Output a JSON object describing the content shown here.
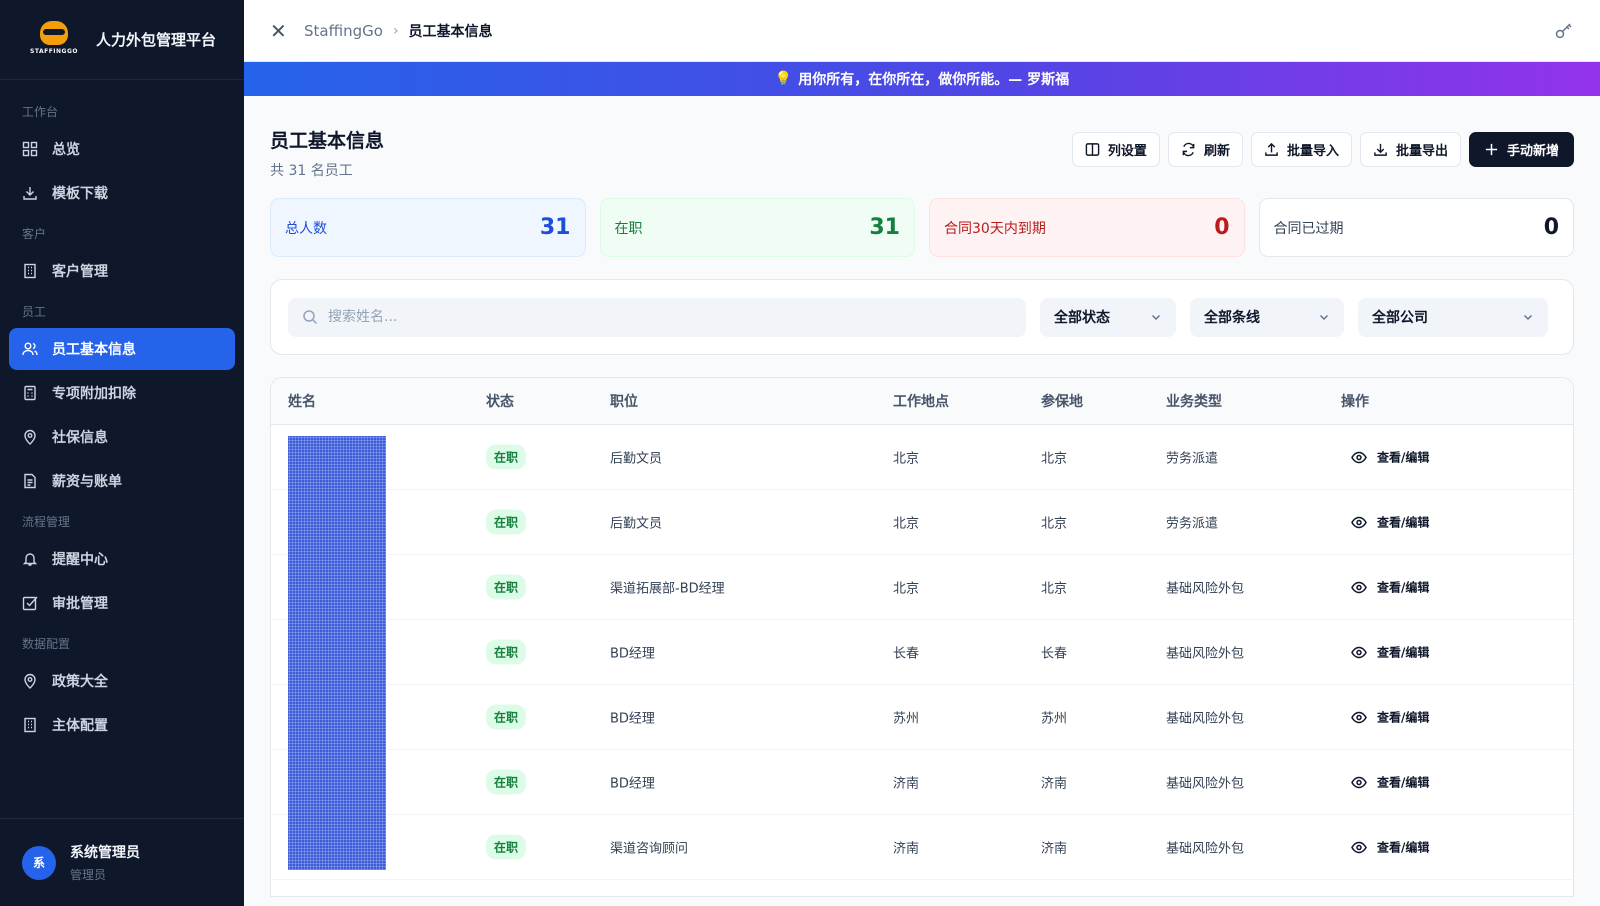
{
  "app": {
    "brand_title": "人力外包管理平台",
    "logo_text": "STAFFINGGO"
  },
  "sidebar": {
    "groups": [
      {
        "label": "工作台",
        "items": [
          {
            "label": "总览",
            "icon": "grid-icon"
          },
          {
            "label": "模板下载",
            "icon": "download-icon"
          }
        ]
      },
      {
        "label": "客户",
        "items": [
          {
            "label": "客户管理",
            "icon": "building-icon"
          }
        ]
      },
      {
        "label": "员工",
        "items": [
          {
            "label": "员工基本信息",
            "icon": "users-icon",
            "active": true
          },
          {
            "label": "专项附加扣除",
            "icon": "calculator-icon"
          },
          {
            "label": "社保信息",
            "icon": "map-pin-icon"
          },
          {
            "label": "薪资与账单",
            "icon": "file-text-icon"
          }
        ]
      },
      {
        "label": "流程管理",
        "items": [
          {
            "label": "提醒中心",
            "icon": "bell-icon"
          },
          {
            "label": "审批管理",
            "icon": "check-square-icon"
          }
        ]
      },
      {
        "label": "数据配置",
        "items": [
          {
            "label": "政策大全",
            "icon": "map-pin-icon"
          },
          {
            "label": "主体配置",
            "icon": "building-icon"
          }
        ]
      }
    ],
    "user": {
      "avatar": "系",
      "name": "系统管理员",
      "role": "管理员"
    }
  },
  "topbar": {
    "breadcrumb_root": "StaffingGo",
    "breadcrumb_sep": "›",
    "breadcrumb_current": "员工基本信息"
  },
  "banner": {
    "text": "用你所有，在你所在，做你所能。— 罗斯福"
  },
  "page": {
    "title": "员工基本信息",
    "subtitle": "共 31 名员工"
  },
  "actions": {
    "columns": "列设置",
    "refresh": "刷新",
    "import": "批量导入",
    "export": "批量导出",
    "add": "手动新增"
  },
  "stats": [
    {
      "label": "总人数",
      "value": "31"
    },
    {
      "label": "在职",
      "value": "31"
    },
    {
      "label": "合同30天内到期",
      "value": "0"
    },
    {
      "label": "合同已过期",
      "value": "0"
    }
  ],
  "filters": {
    "search_placeholder": "搜索姓名...",
    "status": "全部状态",
    "line": "全部条线",
    "company": "全部公司"
  },
  "table": {
    "headers": [
      "姓名",
      "状态",
      "职位",
      "工作地点",
      "参保地",
      "业务类型",
      "操作"
    ],
    "rows": [
      {
        "status": "在职",
        "position": "后勤文员",
        "workplace": "北京",
        "insured": "北京",
        "biz": "劳务派遣",
        "op": "查看/编辑"
      },
      {
        "status": "在职",
        "position": "后勤文员",
        "workplace": "北京",
        "insured": "北京",
        "biz": "劳务派遣",
        "op": "查看/编辑"
      },
      {
        "status": "在职",
        "position": "渠道拓展部-BD经理",
        "workplace": "北京",
        "insured": "北京",
        "biz": "基础风险外包",
        "op": "查看/编辑"
      },
      {
        "status": "在职",
        "position": "BD经理",
        "workplace": "长春",
        "insured": "长春",
        "biz": "基础风险外包",
        "op": "查看/编辑"
      },
      {
        "status": "在职",
        "position": "BD经理",
        "workplace": "苏州",
        "insured": "苏州",
        "biz": "基础风险外包",
        "op": "查看/编辑"
      },
      {
        "status": "在职",
        "position": "BD经理",
        "workplace": "济南",
        "insured": "济南",
        "biz": "基础风险外包",
        "op": "查看/编辑"
      },
      {
        "status": "在职",
        "position": "渠道咨询顾问",
        "workplace": "济南",
        "insured": "济南",
        "biz": "基础风险外包",
        "op": "查看/编辑"
      }
    ]
  },
  "colors": {
    "sidebar_bg": "#0f172a",
    "accent": "#2563eb",
    "success": "#15803d",
    "danger": "#b91c1c"
  }
}
